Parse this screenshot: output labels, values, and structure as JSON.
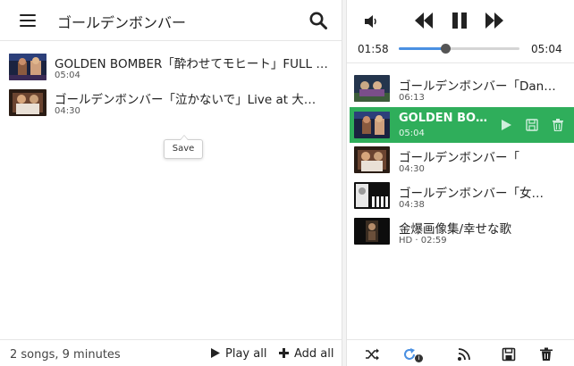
{
  "header": {
    "title": "ゴールデンボンバー"
  },
  "songs": [
    {
      "title": "GOLDEN BOMBER「酔わせてモヒート」FULL …",
      "duration": "05:04"
    },
    {
      "title": "ゴールデンボンバー「泣かないで」Live at 大…",
      "duration": "04:30"
    }
  ],
  "left_footer": {
    "info": "2 songs, 9 minutes",
    "play_all": "Play all",
    "add_all": "Add all"
  },
  "player": {
    "elapsed": "01:58",
    "total": "05:04",
    "progress": 0.387
  },
  "queue": [
    {
      "title": "ゴールデンボンバー「Dan…",
      "sub": "06:13"
    },
    {
      "title": "GOLDEN BO…",
      "sub": "05:04"
    },
    {
      "title": "ゴールデンボンバー「",
      "sub": "04:30"
    },
    {
      "title": "ゴールデンボンバー「女…",
      "sub": "04:38"
    },
    {
      "title": "金爆画像集/幸せな歌",
      "sub": "HD · 02:59"
    }
  ],
  "tooltip": "Save",
  "footer_badge": "i",
  "colors": {
    "accent_green": "#2fae5b",
    "seek_blue": "#4a90e2"
  },
  "icons": [
    "menu-icon",
    "search-icon",
    "volume-icon",
    "previous-icon",
    "pause-icon",
    "next-icon",
    "play-icon",
    "save-icon",
    "trash-icon",
    "shuffle-icon",
    "repeat-icon",
    "rss-icon"
  ]
}
